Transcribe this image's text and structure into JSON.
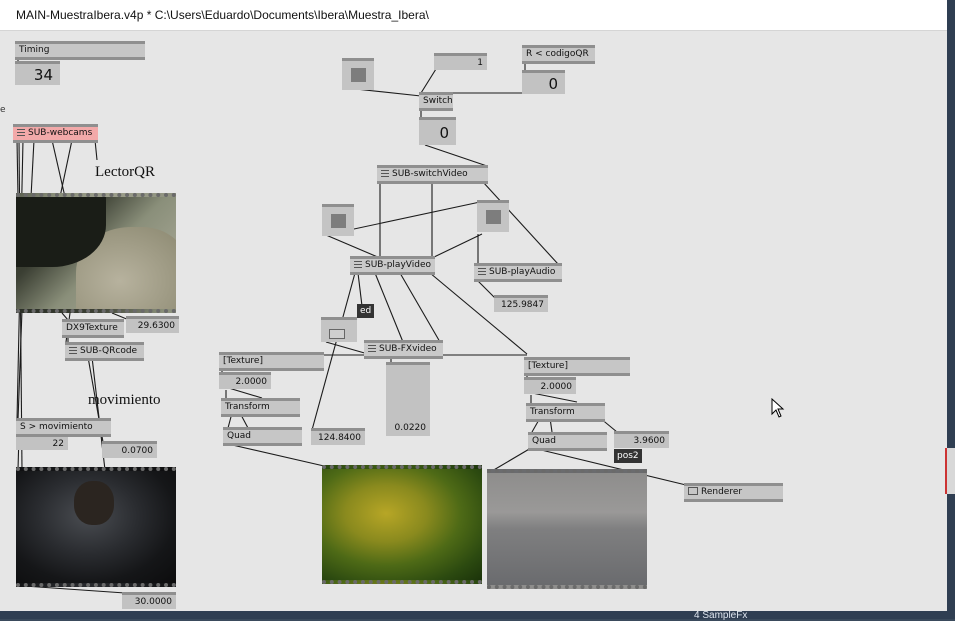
{
  "window": {
    "title": "MAIN-MuestraIbera.v4p *  C:\\Users\\Eduardo\\Documents\\Ibera\\Muestra_Ibera\\"
  },
  "desktop": {
    "bottom_label": "4 SampleFx"
  },
  "nodes": {
    "timing": "Timing",
    "sub_webcams": "SUB-webcams",
    "dx9texture": "DX9Texture",
    "sub_qrcode": "SUB-QRcode",
    "s_movimiento": "S > movimiento",
    "r_codigoqr": "R < codigoQR",
    "switch": "Switch",
    "sub_switchvideo": "SUB-switchVideo",
    "sub_playvideo": "SUB-playVideo",
    "sub_playaudio": "SUB-playAudio",
    "sub_fxvideo": "SUB-FXvideo",
    "texture_1": "[Texture]",
    "transform_1": "Transform",
    "quad_1": "Quad",
    "texture_2": "[Texture]",
    "transform_2": "Transform",
    "quad_2": "Quad",
    "renderer": "Renderer"
  },
  "labels": {
    "lector_qr": "LectorQR",
    "movimiento": "movimiento"
  },
  "values": {
    "timing": "34",
    "switch_in": "1",
    "codigoqr": "0",
    "switch_out": "0",
    "dx9_value": "29.6300",
    "movimiento_count": "22",
    "movimiento_value": "0.0700",
    "bottom_cam": "30.0000",
    "playaudio": "125.9847",
    "fx_value": "0.0220",
    "texture1_scale": "2.0000",
    "quad1_value": "124.8400",
    "texture2_scale": "2.0000",
    "pos2_value": "3.9600"
  },
  "tooltips": {
    "ed": "ed",
    "pos2": "pos2"
  },
  "colors": {
    "node": "#c6c6c6",
    "highlight": "#f2a9a9",
    "canvas": "#e6e6e6"
  }
}
